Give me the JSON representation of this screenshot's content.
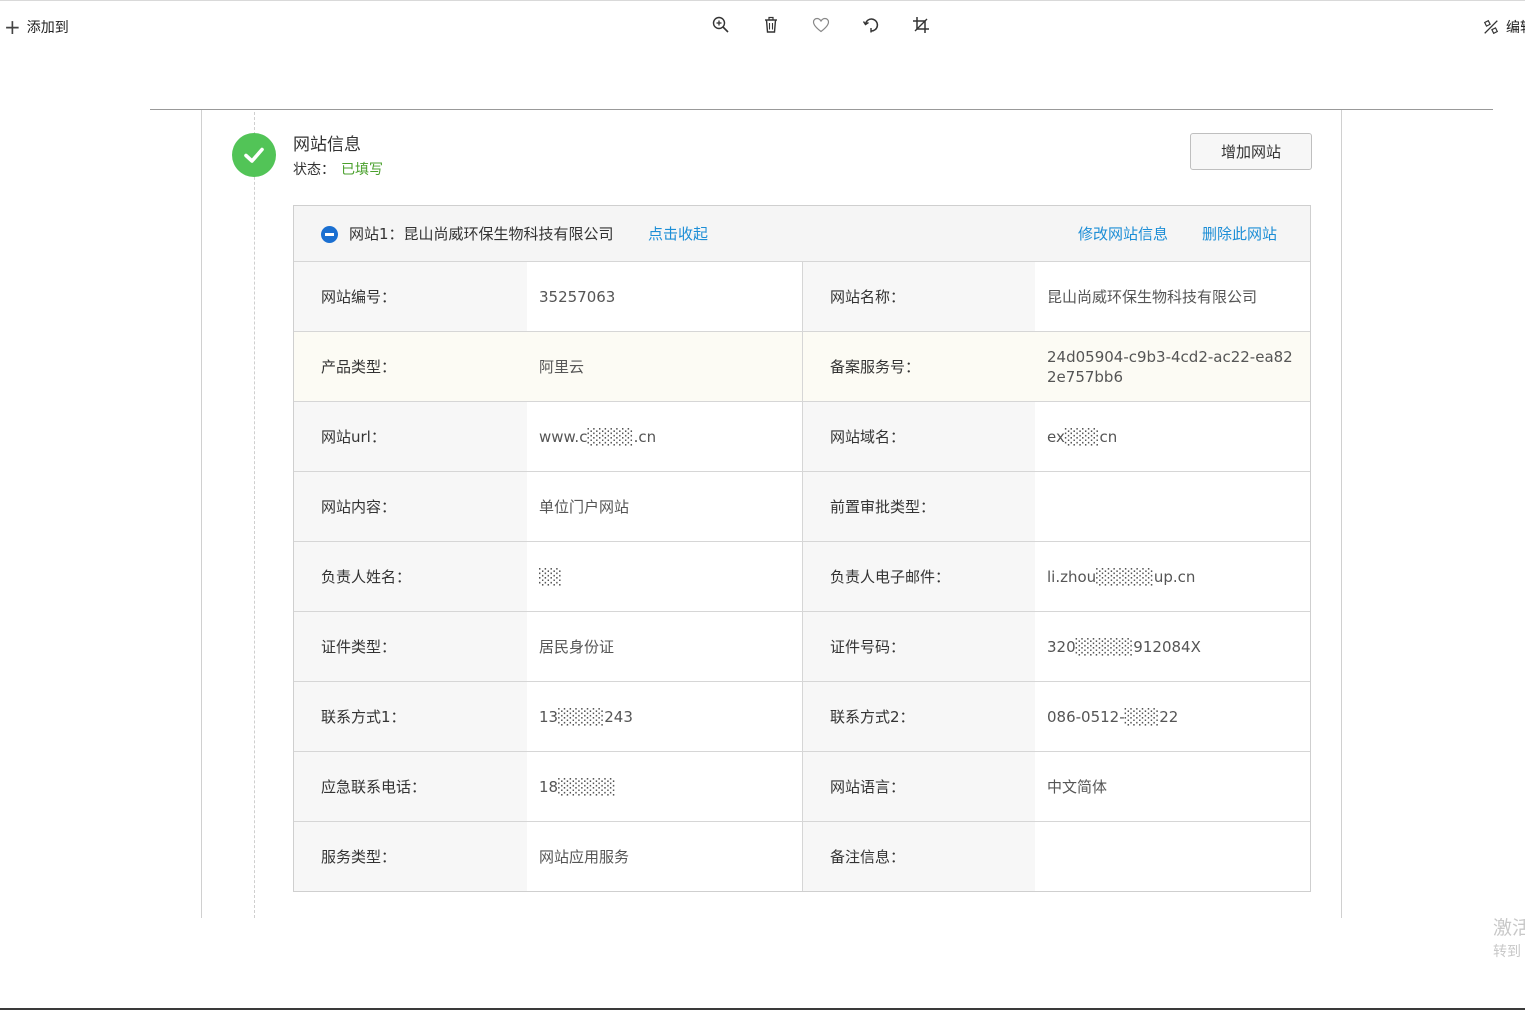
{
  "toolbar": {
    "add_to_label": "添加到",
    "edit_label": "编辑"
  },
  "section": {
    "title": "网站信息",
    "status_label": "状态：",
    "status_value": "已填写",
    "add_site_button": "增加网站"
  },
  "site": {
    "title": "网站1：昆山尚威环保生物科技有限公司",
    "collapse_link": "点击收起",
    "modify_link": "修改网站信息",
    "delete_link": "删除此网站",
    "rows": [
      {
        "label1": "网站编号：",
        "value1": "35257063",
        "label2": "网站名称：",
        "value2": "昆山尚威环保生物科技有限公司"
      },
      {
        "label1": "产品类型：",
        "value1": "阿里云",
        "label2": "备案服务号：",
        "value2": "24d05904-c9b3-4cd2-ac22-ea822e757bb6"
      },
      {
        "label1": "网站url：",
        "value1": "www.c░░░░.cn",
        "label2": "网站域名：",
        "value2": "ex░░░cn"
      },
      {
        "label1": "网站内容：",
        "value1": "单位门户网站",
        "label2": "前置审批类型：",
        "value2": ""
      },
      {
        "label1": "负责人姓名：",
        "value1": "░░",
        "label2": "负责人电子邮件：",
        "value2": "li.zhou░░░░░up.cn"
      },
      {
        "label1": "证件类型：",
        "value1": "居民身份证",
        "label2": "证件号码：",
        "value2": "320░░░░░912084X"
      },
      {
        "label1": "联系方式1：",
        "value1": "13░░░░243",
        "label2": "联系方式2：",
        "value2": "086-0512-░░░22"
      },
      {
        "label1": "应急联系电话：",
        "value1": "18░░░░░",
        "label2": "网站语言：",
        "value2": "中文简体"
      },
      {
        "label1": "服务类型：",
        "value1": "网站应用服务",
        "label2": "备注信息：",
        "value2": ""
      }
    ]
  },
  "watermark": {
    "line1": "激活",
    "line2": "转到"
  },
  "icons": {
    "zoom": "zoom-in-icon",
    "delete": "trash-icon",
    "favorite": "heart-icon",
    "rotate": "rotate-icon",
    "crop": "crop-icon"
  },
  "colors": {
    "accent_link": "#1d8ed6",
    "success": "#52c457",
    "status_text": "#4aa02c",
    "minus_icon": "#1a6fd1"
  }
}
